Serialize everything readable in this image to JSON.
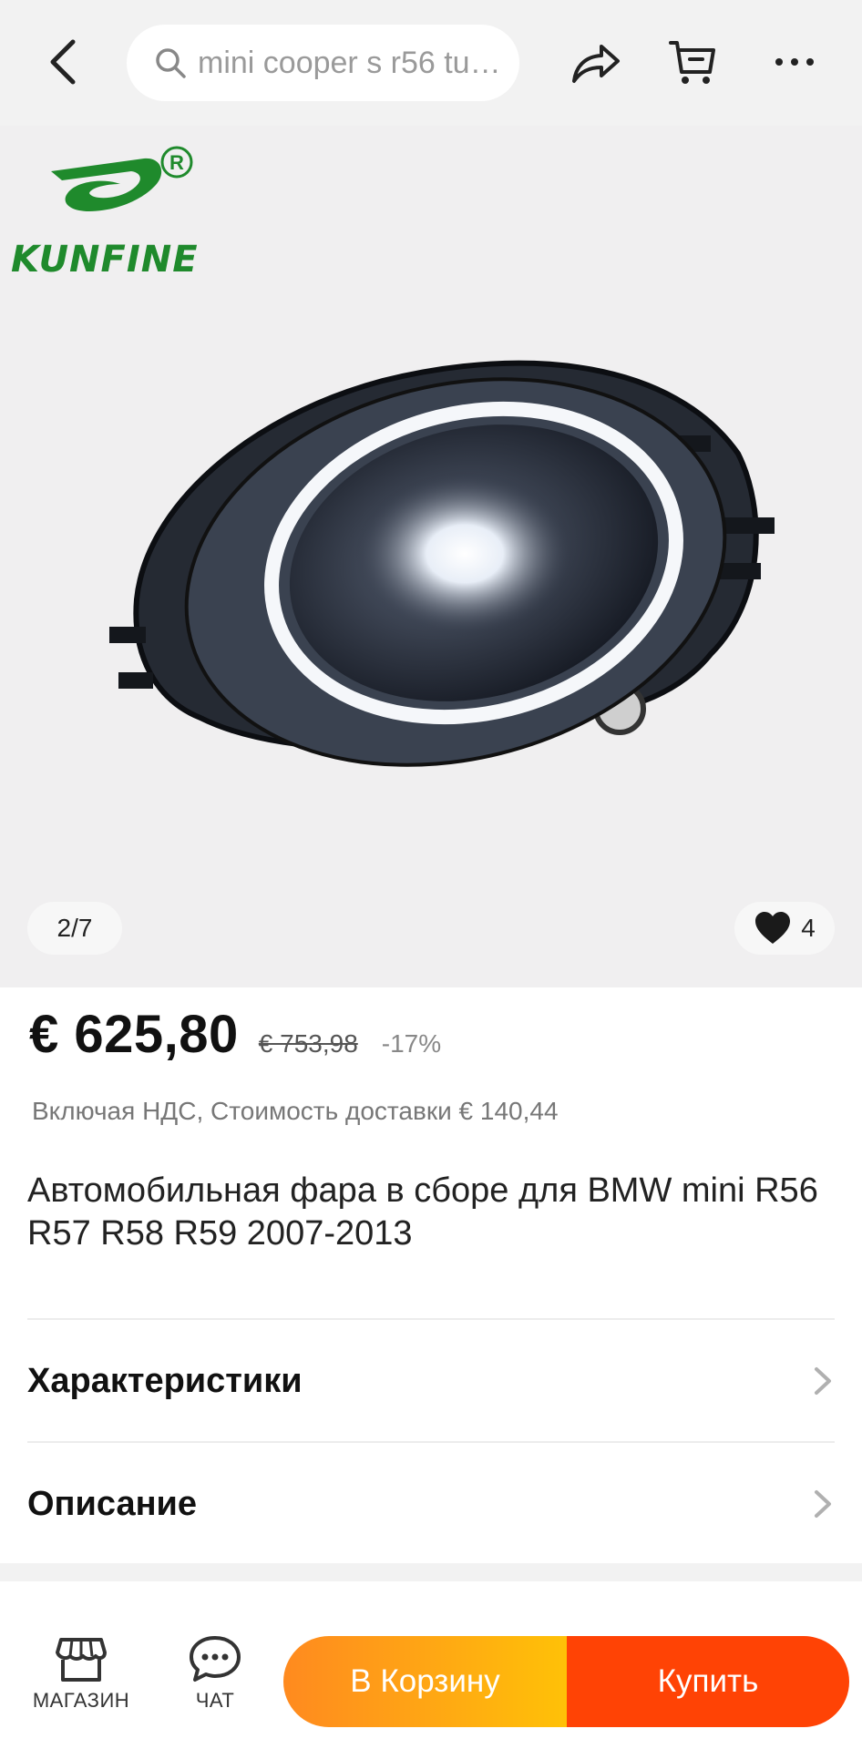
{
  "header": {
    "search_placeholder": "mini cooper s r56 tun...",
    "icons": [
      "back-arrow-icon",
      "search-icon",
      "share-icon",
      "cart-icon",
      "more-icon"
    ]
  },
  "gallery": {
    "brand_name": "KUNFINE",
    "brand_colors": {
      "green": "#1f8a2c"
    },
    "image_counter": "2/7",
    "wishlist_count": "4"
  },
  "product": {
    "price": "€ 625,80",
    "old_price": "€ 753,98",
    "discount": "-17%",
    "tax_note": "Включая НДС, Стоимость доставки € 140,44",
    "title": "Автомобильная фара в сборе для BMW mini R56 R57 R58 R59 2007-2013"
  },
  "sections": [
    {
      "label": "Характеристики"
    },
    {
      "label": "Описание"
    }
  ],
  "bottom_bar": {
    "store_label": "МАГАЗИН",
    "chat_label": "ЧАТ",
    "add_to_cart": "В Корзину",
    "buy_now": "Купить",
    "colors": {
      "cart_gradient_start": "#ff8a1f",
      "cart_gradient_end": "#ffc107",
      "buy": "#ff4305"
    }
  }
}
